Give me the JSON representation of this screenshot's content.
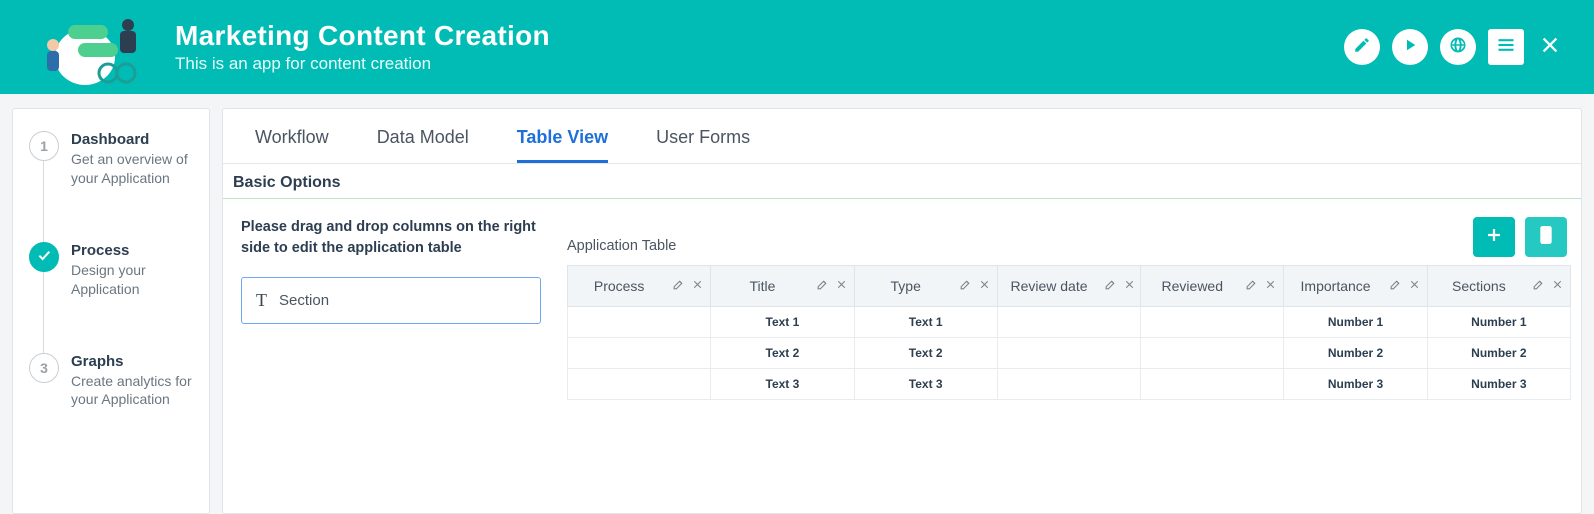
{
  "header": {
    "title": "Marketing Content Creation",
    "subtitle": "This is an app for content creation"
  },
  "sidebar": {
    "steps": [
      {
        "num": "1",
        "title": "Dashboard",
        "desc": "Get an overview of your Application",
        "active": false
      },
      {
        "num": "2",
        "title": "Process",
        "desc": "Design your Application",
        "active": true
      },
      {
        "num": "3",
        "title": "Graphs",
        "desc": "Create analytics for your Application",
        "active": false
      }
    ]
  },
  "tabs": {
    "items": [
      "Workflow",
      "Data Model",
      "Table View",
      "User Forms"
    ],
    "active": 2
  },
  "section_title": "Basic Options",
  "instructions": "Please drag and drop columns on the right side to edit the application table",
  "drag_item": {
    "label": "Section"
  },
  "table": {
    "title": "Application Table",
    "columns": [
      "Process",
      "Title",
      "Type",
      "Review date",
      "Reviewed",
      "Importance",
      "Sections"
    ],
    "rows": [
      [
        "",
        "Text 1",
        "Text 1",
        "",
        "",
        "Number 1",
        "Number 1"
      ],
      [
        "",
        "Text 2",
        "Text 2",
        "",
        "",
        "Number 2",
        "Number 2"
      ],
      [
        "",
        "Text 3",
        "Text 3",
        "",
        "",
        "Number 3",
        "Number 3"
      ]
    ]
  }
}
